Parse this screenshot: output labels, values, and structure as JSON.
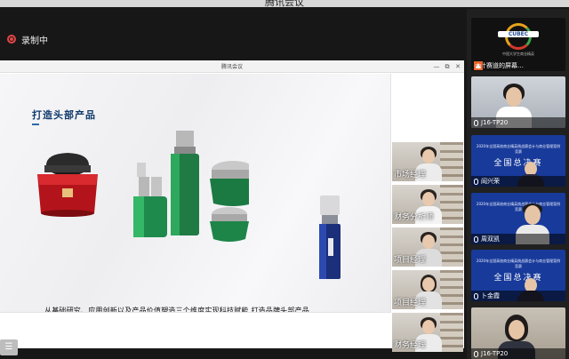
{
  "window": {
    "title": "腾讯会议"
  },
  "recording": {
    "label": "录制中"
  },
  "shared_window": {
    "title": "腾讯会议",
    "controls": {
      "minimize": "—",
      "maximize": "⧉",
      "close": "✕"
    }
  },
  "slide": {
    "title": "打造头部产品",
    "caption": "从基础研究、应用创新以及产品价值塑造三个维度实现科技赋能,打造品牌头部产品",
    "menu_icon": "☰"
  },
  "participants": [
    {
      "label": "市场经理"
    },
    {
      "label": "财务分析师"
    },
    {
      "label": "项目经理"
    },
    {
      "label": "项目经理"
    },
    {
      "label": "财务经理"
    }
  ],
  "strip": {
    "logo": {
      "text": "CUBEC",
      "sub": "中国大学生商业精英",
      "name": "会计赛道的屏幕…"
    },
    "p1": {
      "name": "J16-TP20"
    },
    "c1": {
      "title": "2020年全国高校商业精英挑战赛会计与商业管理案例竞赛",
      "big": "全国总决赛",
      "name": "阎兴荣"
    },
    "c2": {
      "title": "2020年全国高校商业精英挑战赛会计与商业管理案例竞赛",
      "big": "",
      "name": "周双凯"
    },
    "c3": {
      "title": "2020年全国高校商业精英挑战赛会计与商业管理案例竞赛",
      "big": "全国总决赛",
      "name": "卜金霞"
    },
    "p2": {
      "name": "J16-TP20"
    }
  },
  "colors": {
    "accent_title": "#0f3a6c",
    "recording": "#e24646",
    "conference_blue": "#183a9a"
  }
}
